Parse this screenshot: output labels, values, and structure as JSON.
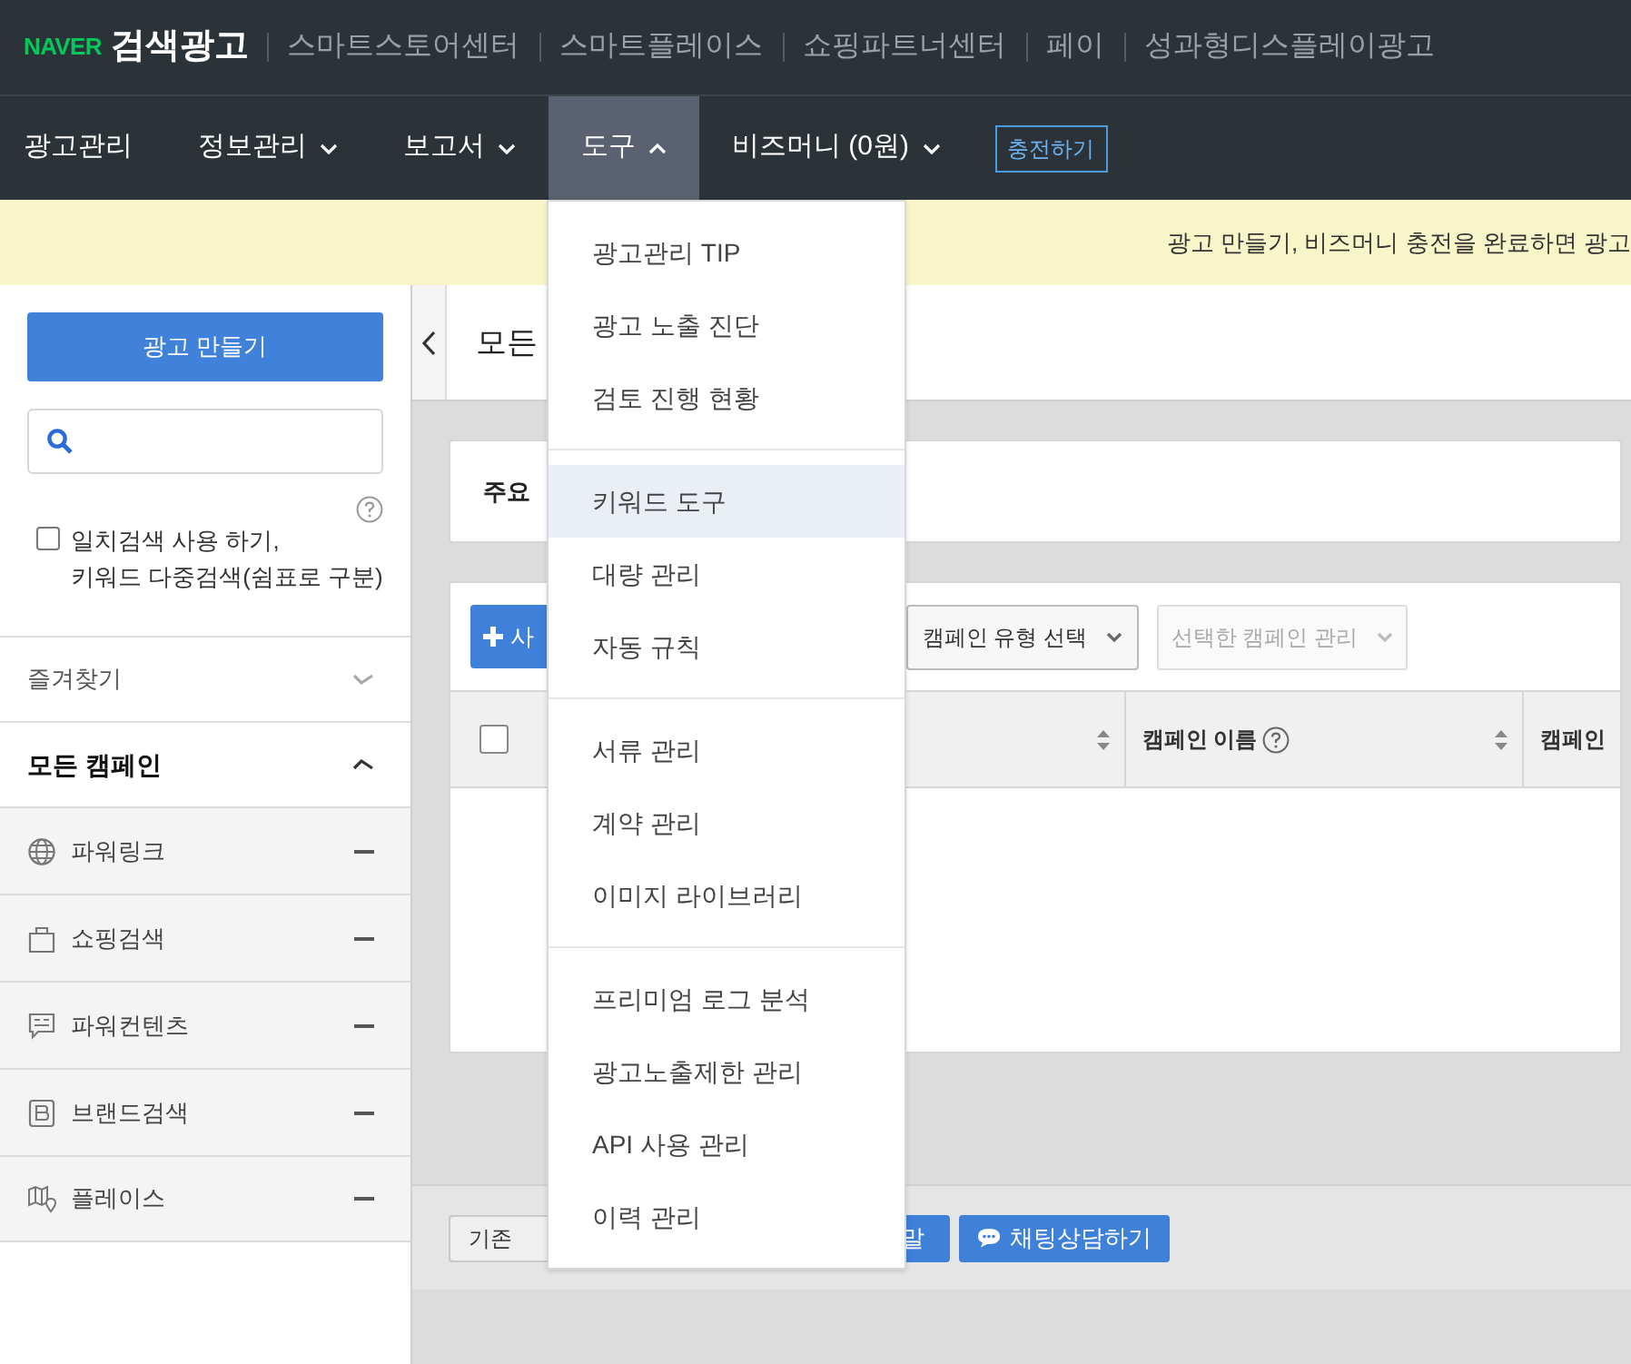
{
  "top_bar": {
    "logo_brand": "NAVER",
    "logo_title": "검색광고",
    "links": [
      "스마트스토어센터",
      "스마트플레이스",
      "쇼핑파트너센터",
      "페이",
      "성과형디스플레이광고"
    ]
  },
  "nav": {
    "items": [
      {
        "label": "광고관리",
        "selected": false,
        "kind": "link"
      },
      {
        "label": "정보관리",
        "selected": false,
        "kind": "dropdown",
        "expanded": false
      },
      {
        "label": "보고서",
        "selected": false,
        "kind": "dropdown",
        "expanded": false
      },
      {
        "label": "도구",
        "selected": true,
        "kind": "dropdown",
        "expanded": true
      },
      {
        "label": "비즈머니 (0원)",
        "selected": false,
        "kind": "dropdown",
        "expanded": false
      }
    ],
    "charge_button": "충전하기"
  },
  "banner": {
    "text": "광고 만들기, 비즈머니 충전을 완료하면 광고"
  },
  "tools_menu": {
    "groups": [
      [
        {
          "label": "광고관리 TIP",
          "selected": false
        },
        {
          "label": "광고 노출 진단",
          "selected": false
        },
        {
          "label": "검토 진행 현황",
          "selected": false
        }
      ],
      [
        {
          "label": "키워드 도구",
          "selected": true
        },
        {
          "label": "대량 관리",
          "selected": false
        },
        {
          "label": "자동 규칙",
          "selected": false
        }
      ],
      [
        {
          "label": "서류 관리",
          "selected": false
        },
        {
          "label": "계약 관리",
          "selected": false
        },
        {
          "label": "이미지 라이브러리",
          "selected": false
        }
      ],
      [
        {
          "label": "프리미엄 로그 분석",
          "selected": false
        },
        {
          "label": "광고노출제한 관리",
          "selected": false
        },
        {
          "label": "API 사용 관리",
          "selected": false
        },
        {
          "label": "이력 관리",
          "selected": false
        }
      ]
    ]
  },
  "sidebar": {
    "create_button": "광고 만들기",
    "exact_search": {
      "checked": false,
      "label_lines": [
        "일치검색 사용 하기,",
        "키워드 다중검색(쉼표로 구분)"
      ]
    },
    "favorites": {
      "label": "즐겨찾기",
      "expanded": false
    },
    "all_campaigns": {
      "label": "모든 캠페인",
      "expanded": true
    },
    "campaign_types": [
      {
        "label": "파워링크"
      },
      {
        "label": "쇼핑검색"
      },
      {
        "label": "파워컨텐츠"
      },
      {
        "label": "브랜드검색"
      },
      {
        "label": "플레이스"
      }
    ]
  },
  "main": {
    "page_title": "모든",
    "summary_title": "주요",
    "toolbar": {
      "add_button": "사",
      "type_select": "캠페인 유형 선택",
      "manage_select": {
        "label": "선택한 캠페인 관리",
        "disabled": true
      }
    },
    "table": {
      "select_all_checked": false,
      "columns": [
        {
          "label": "캠페인 이름",
          "help": true,
          "sortable": true
        },
        {
          "label": "캠페인",
          "help": false,
          "sortable": false
        }
      ]
    },
    "footer_buttons": [
      {
        "kind": "plain",
        "label": "기존"
      },
      {
        "kind": "help",
        "label": "말"
      },
      {
        "kind": "chat",
        "label": "채팅상담하기"
      }
    ]
  }
}
